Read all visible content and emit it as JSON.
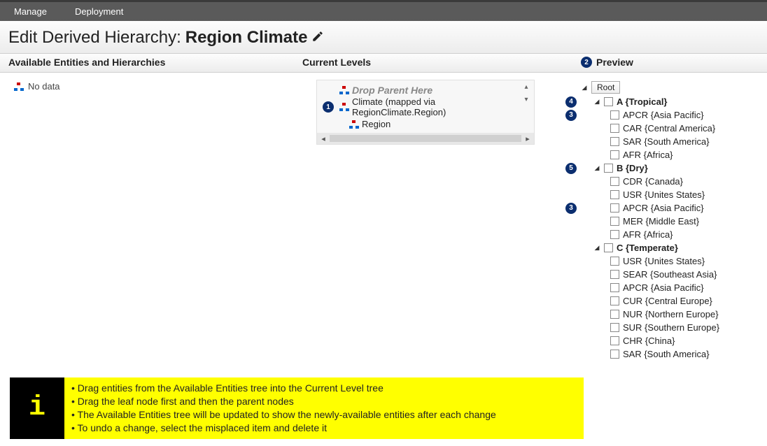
{
  "menubar": {
    "manage": "Manage",
    "deployment": "Deployment"
  },
  "title": {
    "prefix": "Edit Derived Hierarchy: ",
    "name": "Region Climate"
  },
  "headers": {
    "available": "Available Entities and Hierarchies",
    "current": "Current Levels",
    "preview": "Preview"
  },
  "badges": {
    "preview": "2",
    "climate": "1",
    "a": "4",
    "apcr1": "3",
    "b": "5",
    "apcr2": "3"
  },
  "available": {
    "nodata": "No data"
  },
  "current": {
    "drop_here": "Drop Parent Here",
    "climate": "Climate (mapped via RegionClimate.Region)",
    "region": "Region"
  },
  "preview": {
    "root": "Root",
    "groups": [
      {
        "key": "a",
        "label": "A {Tropical}",
        "badge": "4",
        "items": [
          {
            "label": "APCR {Asia Pacific}",
            "badge": "3"
          },
          {
            "label": "CAR {Central America}"
          },
          {
            "label": "SAR {South America}"
          },
          {
            "label": "AFR {Africa}"
          }
        ]
      },
      {
        "key": "b",
        "label": "B {Dry}",
        "badge": "5",
        "items": [
          {
            "label": "CDR {Canada}"
          },
          {
            "label": "USR {Unites States}"
          },
          {
            "label": "APCR {Asia Pacific}",
            "badge": "3"
          },
          {
            "label": "MER {Middle East}"
          },
          {
            "label": "AFR {Africa}"
          }
        ]
      },
      {
        "key": "c",
        "label": "C {Temperate}",
        "items": [
          {
            "label": "USR {Unites States}"
          },
          {
            "label": "SEAR {Southeast Asia}"
          },
          {
            "label": "APCR {Asia Pacific}"
          },
          {
            "label": "CUR {Central Europe}"
          },
          {
            "label": "NUR {Northern Europe}"
          },
          {
            "label": "SUR {Southern Europe}"
          },
          {
            "label": "CHR {China}"
          },
          {
            "label": "SAR {South America}"
          }
        ]
      }
    ]
  },
  "help": {
    "lines": [
      "Drag entities from the Available Entities tree into the Current Level tree",
      "Drag the leaf node first and then the parent nodes",
      "The Available Entities tree will be updated to show the newly-available entities after each change",
      "To undo a change, select the misplaced item and delete it"
    ]
  }
}
